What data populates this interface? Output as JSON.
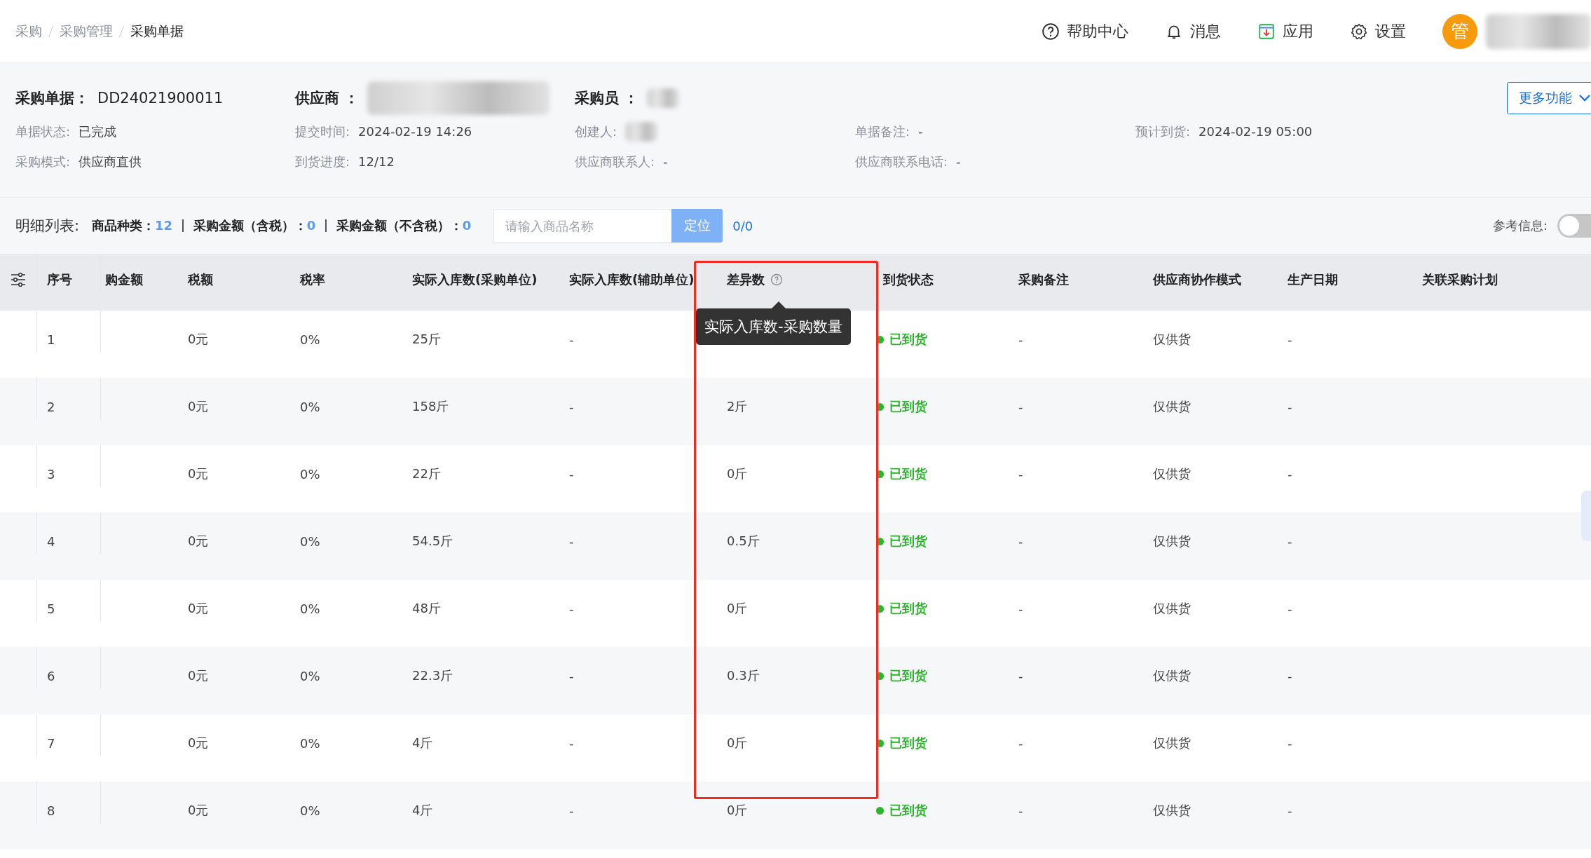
{
  "breadcrumb": [
    {
      "label": "采购",
      "selected": false
    },
    {
      "label": "采购管理",
      "selected": false
    },
    {
      "label": "采购单据",
      "selected": true
    }
  ],
  "top_nav": [
    {
      "label": "帮助中心",
      "kind": "help"
    },
    {
      "label": "消息",
      "kind": "bell"
    },
    {
      "label": "应用",
      "kind": "app"
    },
    {
      "label": "设置",
      "kind": "gear"
    }
  ],
  "user": {
    "avatar_text": "管"
  },
  "order": {
    "number_label": "采购单据：",
    "number": "DD24021900011",
    "supplier_label": "供应商 ：",
    "buyer_label": "采购员 ："
  },
  "more_button": {
    "label": "更多功能"
  },
  "fields": [
    [
      {
        "label": "单据状态:",
        "value": "已完成"
      },
      {
        "label": "提交时间:",
        "value": "2024-02-19 14:26"
      },
      {
        "label": "创建人:",
        "redacted": true
      },
      {
        "label": "单据备注:",
        "value": "-"
      },
      {
        "label": "预计到货:",
        "value": "2024-02-19 05:00"
      }
    ],
    [
      {
        "label": "采购模式:",
        "value": "供应商直供"
      },
      {
        "label": "到货进度:",
        "value": "12/12"
      },
      {
        "label": "供应商联系人:",
        "value": "-"
      },
      {
        "label": "供应商联系电话:",
        "value": "-"
      }
    ]
  ],
  "summary": {
    "title": "明细列表:",
    "items": [
      {
        "label": "商品种类：",
        "value": "12"
      },
      {
        "label": "采购金额（含税）：",
        "value": "0"
      },
      {
        "label": "采购金额（不含税）：",
        "value": "0"
      }
    ]
  },
  "search": {
    "placeholder": "请输入商品名称",
    "button": "定位",
    "count": "0/0"
  },
  "reference": {
    "label": "参考信息:",
    "on": false
  },
  "table": {
    "columns": [
      "序号",
      "购金额",
      "税额",
      "税率",
      "实际入库数(采购单位)",
      "实际入库数(辅助单位)",
      "差异数",
      "到货状态",
      "采购备注",
      "供应商协作模式",
      "生产日期",
      "关联采购计划"
    ],
    "rows": [
      {
        "cells": [
          "1",
          "",
          "0元",
          "0%",
          "25斤",
          "-",
          "",
          "已到货",
          "-",
          "仅供货",
          "-",
          ""
        ]
      },
      {
        "cells": [
          "2",
          "",
          "0元",
          "0%",
          "158斤",
          "-",
          "2斤",
          "已到货",
          "-",
          "仅供货",
          "-",
          ""
        ]
      },
      {
        "cells": [
          "3",
          "",
          "0元",
          "0%",
          "22斤",
          "-",
          "0斤",
          "已到货",
          "-",
          "仅供货",
          "-",
          ""
        ]
      },
      {
        "cells": [
          "4",
          "",
          "0元",
          "0%",
          "54.5斤",
          "-",
          "0.5斤",
          "已到货",
          "-",
          "仅供货",
          "-",
          ""
        ]
      },
      {
        "cells": [
          "5",
          "",
          "0元",
          "0%",
          "48斤",
          "-",
          "0斤",
          "已到货",
          "-",
          "仅供货",
          "-",
          ""
        ]
      },
      {
        "cells": [
          "6",
          "",
          "0元",
          "0%",
          "22.3斤",
          "-",
          "0.3斤",
          "已到货",
          "-",
          "仅供货",
          "-",
          ""
        ]
      },
      {
        "cells": [
          "7",
          "",
          "0元",
          "0%",
          "4斤",
          "-",
          "0斤",
          "已到货",
          "-",
          "仅供货",
          "-",
          ""
        ]
      },
      {
        "cells": [
          "8",
          "",
          "0元",
          "0%",
          "4斤",
          "-",
          "0斤",
          "已到货",
          "-",
          "仅供货",
          "-",
          ""
        ]
      }
    ]
  },
  "tooltip": {
    "text": "实际入库数-采购数量"
  }
}
